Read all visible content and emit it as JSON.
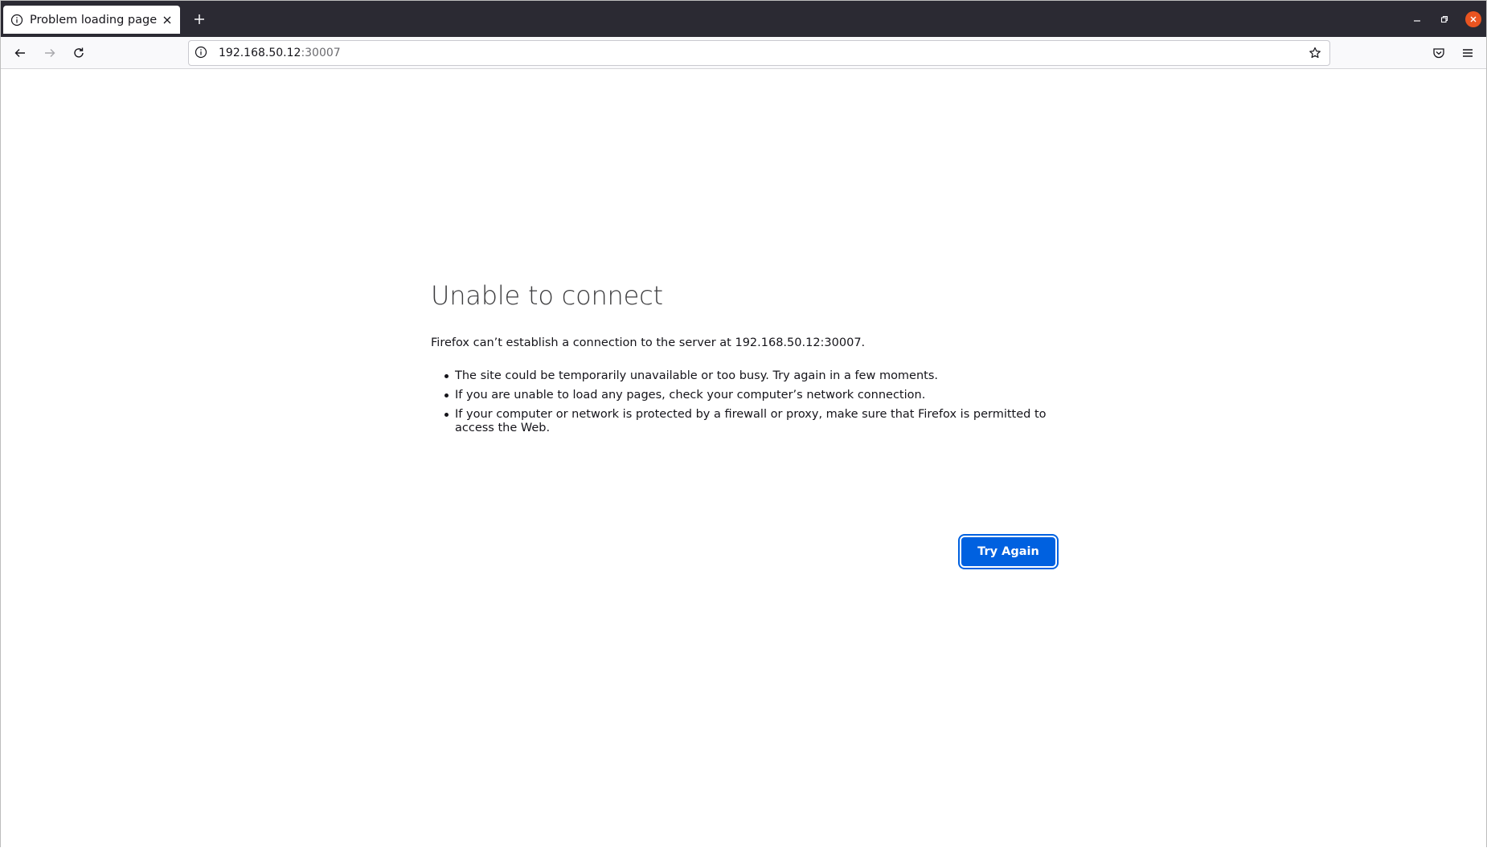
{
  "tab": {
    "title": "Problem loading page"
  },
  "urlbar": {
    "host": "192.168.50.12",
    "port": ":30007"
  },
  "error": {
    "title": "Unable to connect",
    "description": "Firefox can’t establish a connection to the server at 192.168.50.12:30007.",
    "bullets": [
      "The site could be temporarily unavailable or too busy. Try again in a few moments.",
      "If you are unable to load any pages, check your computer’s network connection.",
      "If your computer or network is protected by a firewall or proxy, make sure that Firefox is permitted to access the Web."
    ],
    "button_label": "Try Again"
  },
  "colors": {
    "titlebar": "#2b2a33",
    "accent": "#0061e0",
    "close_button": "#e95420"
  },
  "icons": {
    "tab_info": "info-icon",
    "tab_close": "close-icon",
    "new_tab": "plus-icon",
    "back": "back-arrow-icon",
    "forward": "forward-arrow-icon",
    "reload": "reload-icon",
    "site_info": "info-icon",
    "bookmark": "star-icon",
    "pocket": "pocket-icon",
    "menu": "hamburger-menu-icon"
  }
}
